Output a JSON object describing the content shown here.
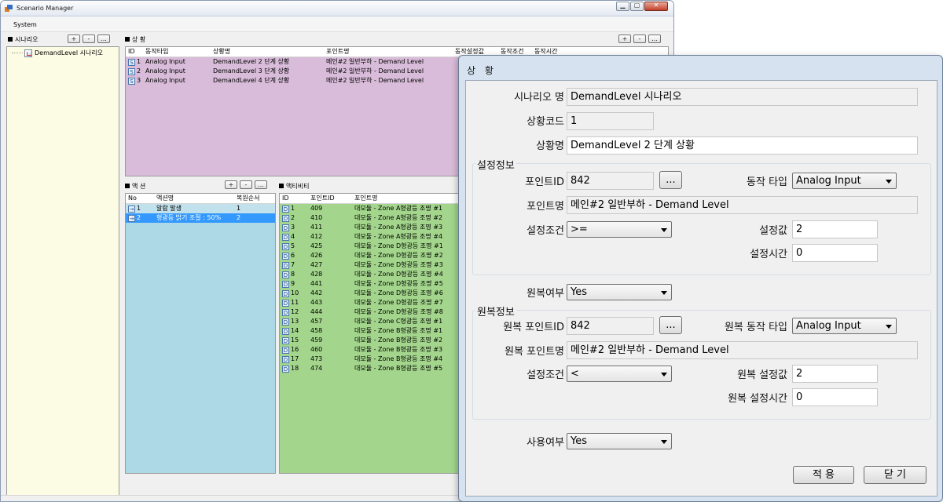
{
  "window": {
    "title": "Scenario Manager"
  },
  "menu": {
    "system": "System"
  },
  "scenario_panel": {
    "label": "시나리오",
    "buttons": [
      "+",
      "-",
      "..."
    ],
    "tree_item": "DemandLevel 시나리오"
  },
  "situation_panel": {
    "label": "상 황",
    "buttons": [
      "+",
      "-",
      "..."
    ],
    "columns": [
      "ID",
      "동작타입",
      "상황명",
      "포인트명",
      "동작설정값",
      "동작조건",
      "동작시간"
    ],
    "rows": [
      {
        "id": "1",
        "type": "Analog Input",
        "name": "DemandLevel 2 단계 상황",
        "point": "메인#2 일반부하 - Demand Level"
      },
      {
        "id": "2",
        "type": "Analog Input",
        "name": "DemandLevel 3 단계 상황",
        "point": "메인#2 일반부하 - Demand Level"
      },
      {
        "id": "3",
        "type": "Analog Input",
        "name": "DemandLevel 4 단계 상황",
        "point": "메인#2 일반부하 - Demand Level"
      }
    ]
  },
  "action_panel": {
    "label": "액 션",
    "buttons": [
      "+",
      "-",
      "..."
    ],
    "columns": [
      "No",
      "액션명",
      "복원순서"
    ],
    "rows": [
      {
        "no": "1",
        "name": "알람 발생",
        "order": "1"
      },
      {
        "no": "2",
        "name": "형광등 밝기 조절 : 50%",
        "order": "2"
      }
    ]
  },
  "activity_panel": {
    "label": "액티비티",
    "columns": [
      "ID",
      "포인트ID",
      "포인트명"
    ],
    "rows": [
      {
        "id": "1",
        "pid": "409",
        "name": "대모듈 - Zone A형광등 조명 #1"
      },
      {
        "id": "2",
        "pid": "410",
        "name": "대모듈 - Zone A형광등 조명 #2"
      },
      {
        "id": "3",
        "pid": "411",
        "name": "대모듈 - Zone A형광등 조명 #3"
      },
      {
        "id": "4",
        "pid": "412",
        "name": "대모듈 - Zone A형광등 조명 #4"
      },
      {
        "id": "5",
        "pid": "425",
        "name": "대모듈 - Zone D형광등 조명 #1"
      },
      {
        "id": "6",
        "pid": "426",
        "name": "대모듈 - Zone D형광등 조명 #2"
      },
      {
        "id": "7",
        "pid": "427",
        "name": "대모듈 - Zone D형광등 조명 #3"
      },
      {
        "id": "8",
        "pid": "428",
        "name": "대모듈 - Zone D형광등 조명 #4"
      },
      {
        "id": "9",
        "pid": "441",
        "name": "대모듈 - Zone D형광등 조명 #5"
      },
      {
        "id": "10",
        "pid": "442",
        "name": "대모듈 - Zone D형광등 조명 #6"
      },
      {
        "id": "11",
        "pid": "443",
        "name": "대모듈 - Zone D형광등 조명 #7"
      },
      {
        "id": "12",
        "pid": "444",
        "name": "대모듈 - Zone D형광등 조명 #8"
      },
      {
        "id": "13",
        "pid": "457",
        "name": "대모듈 - Zone C형광등 조명 #1"
      },
      {
        "id": "14",
        "pid": "458",
        "name": "대모듈 - Zone B형광등 조명 #1"
      },
      {
        "id": "15",
        "pid": "459",
        "name": "대모듈 - Zone B형광등 조명 #2"
      },
      {
        "id": "16",
        "pid": "460",
        "name": "대모듈 - Zone B형광등 조명 #3"
      },
      {
        "id": "17",
        "pid": "473",
        "name": "대모듈 - Zone B형광등 조명 #4"
      },
      {
        "id": "18",
        "pid": "474",
        "name": "대모듈 - Zone B형광등 조명 #5"
      }
    ]
  },
  "dialog": {
    "title": "상 황",
    "scenario_name_label": "시나리오 명",
    "scenario_name": "DemandLevel 시나리오",
    "code_label": "상황코드",
    "code": "1",
    "situation_name_label": "상황명",
    "situation_name": "DemandLevel 2 단계 상황",
    "setting_group": "설정정보",
    "point_id_label": "포인트ID",
    "point_id": "842",
    "browse": "...",
    "action_type_label": "동작 타입",
    "action_type": "Analog Input",
    "point_name_label": "포인트명",
    "point_name": "메인#2 일반부하 - Demand Level",
    "condition_label": "설정조건",
    "condition": ">=",
    "set_value_label": "설정값",
    "set_value": "2",
    "set_time_label": "설정시간",
    "set_time": "0",
    "restore_label": "원복여부",
    "restore": "Yes",
    "restore_group": "원복정보",
    "restore_point_id_label": "원복 포인트ID",
    "restore_point_id": "842",
    "restore_action_type_label": "원복 동작 타입",
    "restore_action_type": "Analog Input",
    "restore_point_name_label": "원복 포인트명",
    "restore_point_name": "메인#2 일반부하 - Demand Level",
    "restore_condition_label": "설정조건",
    "restore_condition": "<",
    "restore_set_value_label": "원복 설정값",
    "restore_set_value": "2",
    "restore_set_time_label": "원복 설정시간",
    "restore_set_time": "0",
    "use_label": "사용여부",
    "use": "Yes",
    "apply": "적 용",
    "close": "닫 기"
  }
}
